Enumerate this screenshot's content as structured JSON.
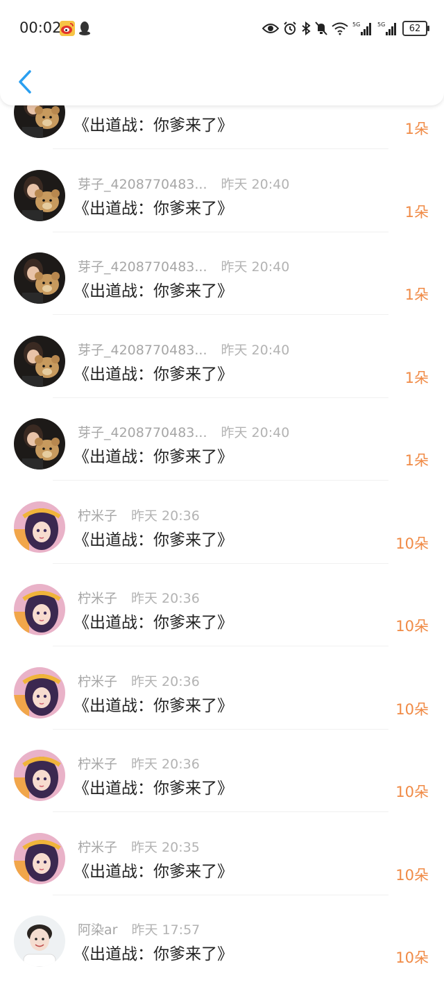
{
  "status": {
    "time": "00:02",
    "battery": "62",
    "network_labels": [
      "5G",
      "5G"
    ]
  },
  "colors": {
    "accent": "#2a9ff0",
    "amount": "#f08a45"
  },
  "items": [
    {
      "name": "",
      "stamp": "",
      "title": "《出道战：你爹来了》",
      "amount": "1朵",
      "avatar": "bear-avatar"
    },
    {
      "name": "芽子_4208770483...",
      "stamp": "昨天 20:40",
      "title": "《出道战：你爹来了》",
      "amount": "1朵",
      "avatar": "bear-avatar"
    },
    {
      "name": "芽子_4208770483...",
      "stamp": "昨天 20:40",
      "title": "《出道战：你爹来了》",
      "amount": "1朵",
      "avatar": "bear-avatar"
    },
    {
      "name": "芽子_4208770483...",
      "stamp": "昨天 20:40",
      "title": "《出道战：你爹来了》",
      "amount": "1朵",
      "avatar": "bear-avatar"
    },
    {
      "name": "芽子_4208770483...",
      "stamp": "昨天 20:40",
      "title": "《出道战：你爹来了》",
      "amount": "1朵",
      "avatar": "bear-avatar"
    },
    {
      "name": "柠米子",
      "stamp": "昨天 20:36",
      "title": "《出道战：你爹来了》",
      "amount": "10朵",
      "avatar": "anime-girl-avatar"
    },
    {
      "name": "柠米子",
      "stamp": "昨天 20:36",
      "title": "《出道战：你爹来了》",
      "amount": "10朵",
      "avatar": "anime-girl-avatar"
    },
    {
      "name": "柠米子",
      "stamp": "昨天 20:36",
      "title": "《出道战：你爹来了》",
      "amount": "10朵",
      "avatar": "anime-girl-avatar"
    },
    {
      "name": "柠米子",
      "stamp": "昨天 20:36",
      "title": "《出道战：你爹来了》",
      "amount": "10朵",
      "avatar": "anime-girl-avatar"
    },
    {
      "name": "柠米子",
      "stamp": "昨天 20:35",
      "title": "《出道战：你爹来了》",
      "amount": "10朵",
      "avatar": "anime-girl-avatar"
    },
    {
      "name": "阿染ar",
      "stamp": "昨天 17:57",
      "title": "《出道战：你爹来了》",
      "amount": "10朵",
      "avatar": "boy-avatar"
    }
  ]
}
